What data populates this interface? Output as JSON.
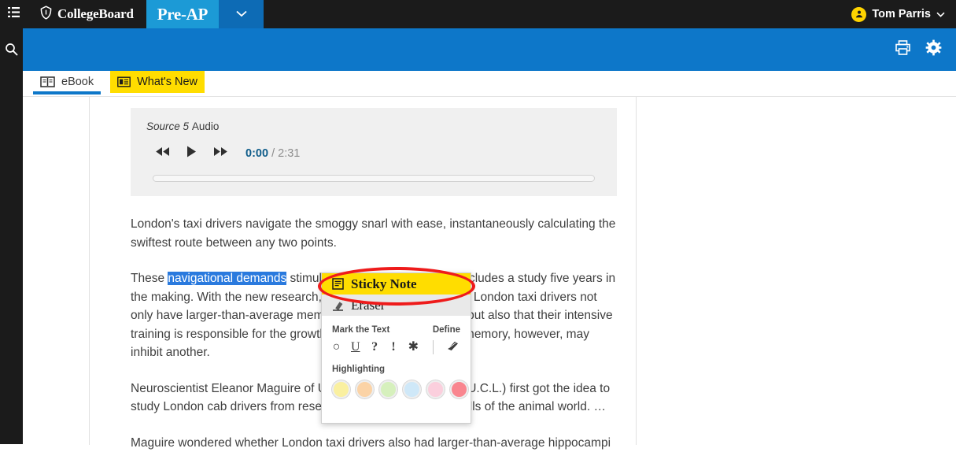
{
  "topbar": {
    "grid_icon": "grid-menu-icon",
    "brand": "CollegeBoard",
    "product_tab": "Pre-AP",
    "product_caret_icon": "chevron-down-icon",
    "user_name": "Tom Parris",
    "user_caret_icon": "chevron-down-icon",
    "avatar_icon": "person-icon",
    "avatar_color": "#ffd400",
    "bg_color": "#1b1b1b"
  },
  "rail": {
    "search_icon": "search-icon"
  },
  "bluebar": {
    "bg_color": "#0d77c9",
    "print_icon": "printer-icon",
    "settings_icon": "gear-icon"
  },
  "tabs": [
    {
      "label": "eBook",
      "icon": "open-book-icon",
      "active": true
    },
    {
      "label": "What's New",
      "icon": "news-card-icon",
      "active": false,
      "highlight_color": "#ffdd00"
    }
  ],
  "audio": {
    "source_label": "Source 5",
    "kind_label": "Audio",
    "rewind_icon": "rewind-icon",
    "play_icon": "play-icon",
    "forward_icon": "fast-forward-icon",
    "current_time": "0:00",
    "time_separator": "/",
    "total_time": "2:31",
    "progress_percent": 0,
    "current_time_color": "#0e5c8a"
  },
  "reader": {
    "paragraphs": [
      {
        "id": "p1",
        "parts": [
          {
            "text": "London's taxi drivers navigate the smoggy snarl with ease, instantaneously calculating the swiftest route between any two points."
          }
        ]
      },
      {
        "id": "p2",
        "parts": [
          {
            "text": "These "
          },
          {
            "text": "navigational demands",
            "selected": true
          },
          {
            "text": " stimulate brain development, concludes a study five years in the making. With the new research, scientists can now say that London taxi drivers not only have larger-than-average memory centers in their brains, but also that their intensive training is responsible for the growth. Sharpening one form of memory, however, may inhibit another."
          }
        ]
      },
      {
        "id": "p3",
        "parts": [
          {
            "text": "Neuroscientist Eleanor Maguire of University College London (U.C.L.) first got the idea to study London cab drivers from research on the navigational skills of the animal world. …"
          }
        ]
      },
      {
        "id": "p4",
        "parts": [
          {
            "text": "Maguire wondered whether London taxi drivers also had larger-than-average hippocampi"
          }
        ]
      }
    ]
  },
  "popup": {
    "sticky_note": {
      "label": "Sticky Note",
      "icon": "sticky-note-icon",
      "highlighted": true,
      "highlight_color": "#ffdd00"
    },
    "eraser": {
      "label": "Eraser",
      "icon": "eraser-icon"
    },
    "mark_the_text_label": "Mark the Text",
    "define_label": "Define",
    "mark_tools": [
      {
        "glyph": "○",
        "name": "circle-mark-tool"
      },
      {
        "glyph": "U",
        "name": "underline-mark-tool",
        "underline": true
      },
      {
        "glyph": "?",
        "name": "question-mark-tool"
      },
      {
        "glyph": "!",
        "name": "exclamation-mark-tool"
      },
      {
        "glyph": "✱",
        "name": "asterisk-mark-tool"
      }
    ],
    "define_icon": "dictionary-book-icon",
    "highlighting_label": "Highlighting",
    "highlight_colors": [
      {
        "name": "yellow",
        "hex": "#faf0a0"
      },
      {
        "name": "orange",
        "hex": "#fbd3a6"
      },
      {
        "name": "green",
        "hex": "#d6f0bd"
      },
      {
        "name": "blue",
        "hex": "#cfe8f8"
      },
      {
        "name": "pink",
        "hex": "#fbcfdd"
      },
      {
        "name": "red",
        "hex": "#f9868f"
      }
    ]
  },
  "annotation": {
    "shape": "red-ellipse",
    "color": "#ee1b1b",
    "targets": "sticky-note-menu-item"
  }
}
